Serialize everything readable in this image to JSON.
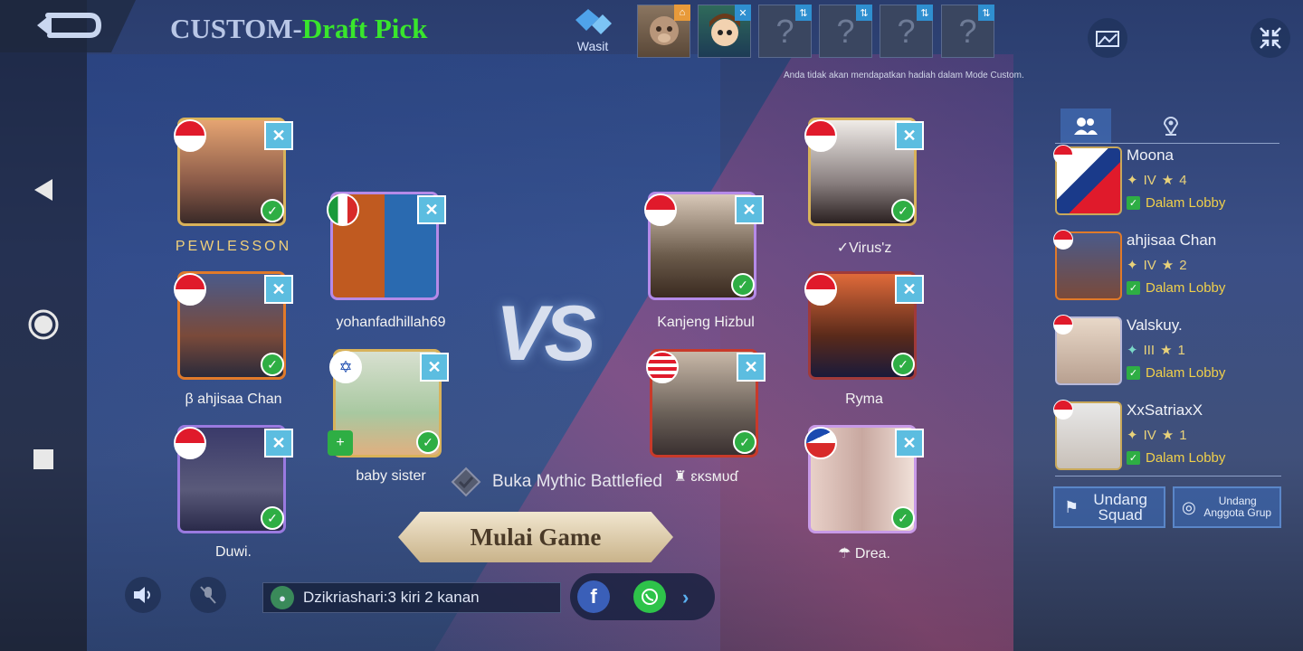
{
  "header": {
    "title_prefix": "CUSTOM-",
    "title_suffix": "Draft Pick",
    "wasit_label": "Wasit",
    "notice": "Anda tidak akan mendapatkan hadiah dalam Mode Custom.",
    "spectator_placeholder": "?"
  },
  "left_team": [
    {
      "name": "PEWLESSON",
      "flag": "Singapore"
    },
    {
      "name": "yohanfadhillah69",
      "flag": "Italy"
    },
    {
      "name": "β ahjisaa Chan",
      "flag": "Indonesia"
    },
    {
      "name": "baby sister",
      "flag": "Israel"
    },
    {
      "name": "Duwi.",
      "flag": "Indonesia"
    }
  ],
  "right_team": [
    {
      "name": "✓Virus'z",
      "flag": "Indonesia"
    },
    {
      "name": "Kanjeng Hizbul",
      "flag": "Indonesia"
    },
    {
      "name": "Ryma",
      "flag": "Indonesia"
    },
    {
      "name": "♜ ɛĸѕмυɗ",
      "flag": "Malaysia"
    },
    {
      "name": "☂ Drea.",
      "flag": "Czech Republic"
    }
  ],
  "center": {
    "vs": "VS",
    "mythic": "Buka Mythic Battlefied",
    "start_button": "Mulai Game"
  },
  "chat": {
    "message": "Dzikriashari:3 kiri 2 kanan"
  },
  "panel": {
    "members": [
      {
        "name": "Moona",
        "rank": "IV",
        "stars": "4",
        "status": "Dalam Lobby"
      },
      {
        "name": "ahjisaa Chan",
        "rank": "IV",
        "stars": "2",
        "status": "Dalam Lobby"
      },
      {
        "name": "Valskuy.",
        "rank": "III",
        "stars": "1",
        "status": "Dalam Lobby"
      },
      {
        "name": "XxSatriaxX",
        "rank": "IV",
        "stars": "1",
        "status": "Dalam Lobby"
      }
    ],
    "invite_squad": "Undang Squad",
    "invite_group": "Undang Anggota Grup"
  },
  "colors": {
    "title_green": "#39e62c",
    "check_green": "#2eae44",
    "x_blue": "#5cbde0",
    "gold": "#d8b25a"
  }
}
